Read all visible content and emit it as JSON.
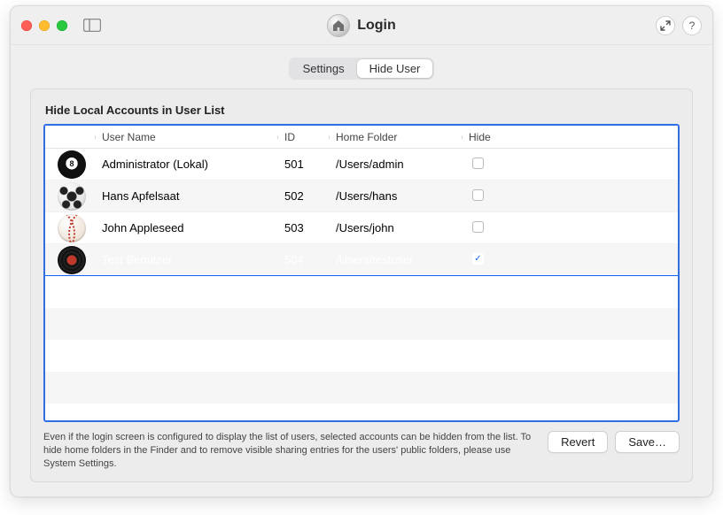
{
  "window": {
    "title": "Login"
  },
  "tabs": {
    "settings": "Settings",
    "hideUser": "Hide User",
    "active": "hideUser"
  },
  "section": {
    "title": "Hide Local Accounts in User List"
  },
  "columns": {
    "userName": "User Name",
    "id": "ID",
    "homeFolder": "Home Folder",
    "hide": "Hide"
  },
  "users": [
    {
      "avatar": "ball8",
      "name": "Administrator (Lokal)",
      "id": "501",
      "home": "/Users/admin",
      "hide": false,
      "selected": false
    },
    {
      "avatar": "soccer",
      "name": "Hans Apfelsaat",
      "id": "502",
      "home": "/Users/hans",
      "hide": false,
      "selected": false
    },
    {
      "avatar": "baseball",
      "name": "John Appleseed",
      "id": "503",
      "home": "/Users/john",
      "hide": false,
      "selected": false
    },
    {
      "avatar": "vinyl",
      "name": "Test Benutzer",
      "id": "504",
      "home": "/Users/testuser",
      "hide": true,
      "selected": true
    }
  ],
  "footer": {
    "note": "Even if the login screen is configured to display the list of users, selected accounts can be hidden from the list. To hide home folders in the Finder and to remove visible sharing entries for the users' public folders, please use System Settings.",
    "revert": "Revert",
    "save": "Save…"
  }
}
